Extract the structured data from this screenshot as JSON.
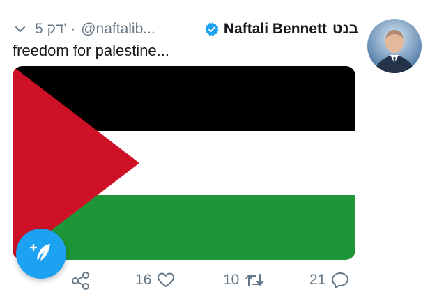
{
  "tweet": {
    "author_name": "Naftali Bennett",
    "author_name_hebrew": "בנט",
    "handle": "@naftalib...",
    "time": "5 דק'",
    "text": "freedom for palestine..."
  },
  "image": {
    "description": "Palestinian flag",
    "colors": {
      "black": "#000000",
      "white": "#ffffff",
      "green": "#1e9637",
      "red": "#ce1126"
    }
  },
  "actions": {
    "reply_count": "21",
    "retweet_count": "10",
    "like_count": "16"
  },
  "icons": [
    "chevron-down-icon",
    "verified-badge-icon",
    "reply-icon",
    "retweet-icon",
    "like-icon",
    "share-icon",
    "compose-tweet-icon"
  ],
  "colors": {
    "accent": "#1da1f2",
    "secondary_text": "#657786",
    "primary_text": "#14171a"
  }
}
